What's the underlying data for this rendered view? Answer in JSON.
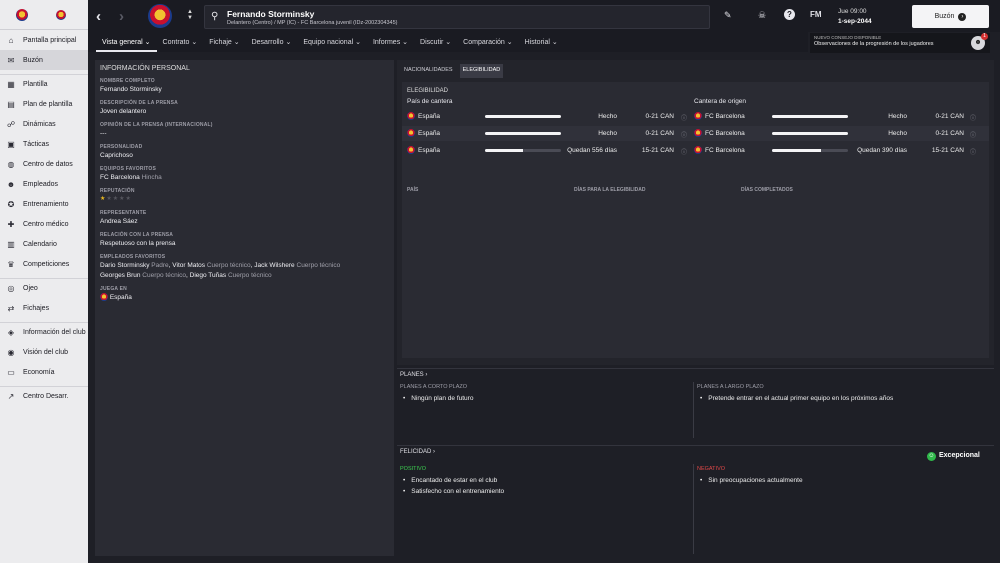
{
  "sidebar": {
    "items": [
      {
        "label": "Pantalla principal",
        "icon": "home-icon",
        "glyph": "⌂"
      },
      {
        "label": "Buzón",
        "icon": "mail-icon",
        "glyph": "✉"
      },
      {
        "label": "Plantilla",
        "icon": "squad-icon",
        "glyph": "▦"
      },
      {
        "label": "Plan de plantilla",
        "icon": "plan-icon",
        "glyph": "▤"
      },
      {
        "label": "Dinámicas",
        "icon": "dynamics-icon",
        "glyph": "☍"
      },
      {
        "label": "Tácticas",
        "icon": "tactics-icon",
        "glyph": "▣"
      },
      {
        "label": "Centro de datos",
        "icon": "data-icon",
        "glyph": "◍"
      },
      {
        "label": "Empleados",
        "icon": "staff-icon",
        "glyph": "☻"
      },
      {
        "label": "Entrenamiento",
        "icon": "training-icon",
        "glyph": "✪"
      },
      {
        "label": "Centro médico",
        "icon": "medical-icon",
        "glyph": "✚"
      },
      {
        "label": "Calendario",
        "icon": "calendar-icon",
        "glyph": "▥"
      },
      {
        "label": "Competiciones",
        "icon": "trophy-icon",
        "glyph": "♛"
      },
      {
        "label": "Ojeo",
        "icon": "scouting-icon",
        "glyph": "◎"
      },
      {
        "label": "Fichajes",
        "icon": "transfers-icon",
        "glyph": "⇄"
      },
      {
        "label": "Información del club",
        "icon": "club-info-icon",
        "glyph": "◈"
      },
      {
        "label": "Visión del club",
        "icon": "club-vision-icon",
        "glyph": "◉"
      },
      {
        "label": "Economía",
        "icon": "finance-icon",
        "glyph": "▭"
      },
      {
        "label": "Centro Desarr.",
        "icon": "development-icon",
        "glyph": "↗"
      }
    ]
  },
  "header": {
    "player_name": "Fernando Storminsky",
    "player_desc": "Delantero (Centro) / MP (IC) - FC Barcelona juvenil (IDz-2002304345)",
    "time": "Jue 09:00",
    "date": "1-sep-2044",
    "fm_label": "FM",
    "buzon_button": "Buzón"
  },
  "tabs": [
    "Vista general",
    "Contrato",
    "Fichaje",
    "Desarrollo",
    "Equipo nacional",
    "Informes",
    "Discutir",
    "Comparación",
    "Historial"
  ],
  "notice": {
    "kicker": "NUEVO CONSEJO DISPONIBLE",
    "text": "Observaciones de la progresión de los jugadores",
    "count": "1"
  },
  "personal": {
    "title": "INFORMACIÓN PERSONAL",
    "full_name_label": "NOMBRE COMPLETO",
    "full_name": "Fernando Storminsky",
    "press_desc_label": "DESCRIPCIÓN DE LA PRENSA",
    "press_desc": "Joven delantero",
    "press_opinion_label": "OPINIÓN DE LA PRENSA (INTERNACIONAL)",
    "press_opinion": "---",
    "personality_label": "PERSONALIDAD",
    "personality": "Caprichoso",
    "fav_teams_label": "EQUIPOS FAVORITOS",
    "fav_team": "FC Barcelona",
    "fav_team_role": "Hincha",
    "reputation_label": "REPUTACIÓN",
    "reputation_stars": 0.5,
    "agent_label": "REPRESENTANTE",
    "agent": "Andrea Sáez",
    "press_rel_label": "RELACIÓN CON LA PRENSA",
    "press_rel": "Respetuoso con la prensa",
    "fav_staff_label": "EMPLEADOS FAVORITOS",
    "fav_staff_line1": [
      {
        "name": "Dario Storminsky",
        "role": "Padre"
      },
      {
        "name": "Vitor Matos",
        "role": "Cuerpo técnico"
      },
      {
        "name": "Jack Wilshere",
        "role": "Cuerpo técnico"
      }
    ],
    "fav_staff_line2": [
      {
        "name": "Georges Brun",
        "role": "Cuerpo técnico"
      },
      {
        "name": "Diego Tuñas",
        "role": "Cuerpo técnico"
      }
    ],
    "plays_in_label": "JUEGA EN",
    "plays_in": "España"
  },
  "eligibility": {
    "subtabs": [
      "NACIONALIDADES",
      "ELEGIBILIDAD"
    ],
    "title": "ELEGIBILIDAD",
    "col_left": "País de cantera",
    "col_right": "Cantera de origen",
    "left_rows": [
      {
        "name": "España",
        "progress": 1.0,
        "status": "Hecho",
        "age": "0-21 CAN"
      },
      {
        "name": "España",
        "progress": 1.0,
        "status": "Hecho",
        "age": "0-21 CAN"
      },
      {
        "name": "España",
        "progress": 0.5,
        "status": "Quedan 556 días",
        "age": "15-21 CAN"
      }
    ],
    "right_rows": [
      {
        "name": "FC Barcelona",
        "progress": 1.0,
        "status": "Hecho",
        "age": "0-21 CAN"
      },
      {
        "name": "FC Barcelona",
        "progress": 1.0,
        "status": "Hecho",
        "age": "0-21 CAN"
      },
      {
        "name": "FC Barcelona",
        "progress": 0.65,
        "status": "Quedan 390 días",
        "age": "15-21 CAN"
      }
    ],
    "foot": [
      "PAÍS",
      "DÍAS PARA LA ELEGIBILIDAD",
      "DÍAS COMPLETADOS"
    ]
  },
  "planes": {
    "title": "PLANES",
    "short_label": "PLANES A CORTO PLAZO",
    "short_item": "Ningún plan de futuro",
    "long_label": "PLANES A LARGO PLAZO",
    "long_item": "Pretende entrar en el actual primer equipo en los próximos años"
  },
  "felicidad": {
    "title": "FELICIDAD",
    "status": "Excepcional",
    "positive_label": "POSITIVO",
    "positive": [
      "Encantado de estar en el club",
      "Satisfecho con el entrenamiento"
    ],
    "negative_label": "NEGATIVO",
    "negative": [
      "Sin preocupaciones actualmente"
    ]
  }
}
